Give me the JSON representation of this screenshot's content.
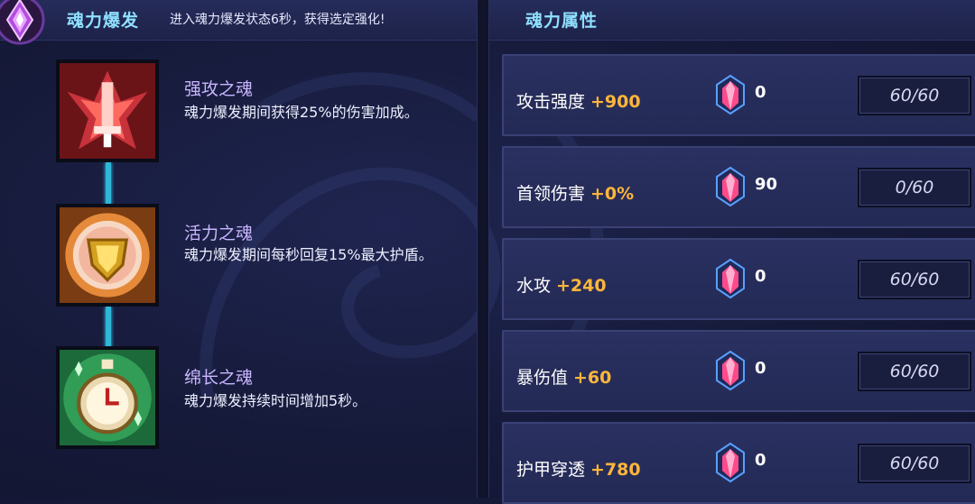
{
  "left_panel": {
    "title": "魂力爆发",
    "subtitle": "进入魂力爆发状态6秒，获得选定强化!",
    "emblem_icon": "purple-diamond-emblem-icon"
  },
  "skills": [
    {
      "name": "强攻之魂",
      "description": "魂力爆发期间获得25%的伤害加成。",
      "icon": "red-sword-soul-icon"
    },
    {
      "name": "活力之魂",
      "description": "魂力爆发期间每秒回复15%最大护盾。",
      "icon": "golden-shield-soul-icon"
    },
    {
      "name": "绵长之魂",
      "description": "魂力爆发持续时间增加5秒。",
      "icon": "green-stopwatch-soul-icon"
    }
  ],
  "right_panel": {
    "title": "魂力属性"
  },
  "stats": [
    {
      "name": "攻击强度",
      "bonus": "+900",
      "crystals": "0",
      "progress": "60/60"
    },
    {
      "name": "首领伤害",
      "bonus": "+0%",
      "crystals": "90",
      "progress": "0/60"
    },
    {
      "name": "水攻",
      "bonus": "+240",
      "crystals": "0",
      "progress": "60/60"
    },
    {
      "name": "暴伤值",
      "bonus": "+60",
      "crystals": "0",
      "progress": "60/60"
    },
    {
      "name": "护甲穿透",
      "bonus": "+780",
      "crystals": "0",
      "progress": "60/60"
    }
  ],
  "colors": {
    "title": "#8fe0ff",
    "skill_name": "#c9b6ff",
    "bonus": "#ffb63a",
    "connector": "#2fb6d8"
  }
}
